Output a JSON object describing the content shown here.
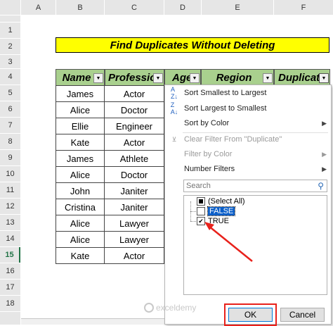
{
  "columns": [
    "A",
    "B",
    "C",
    "D",
    "E",
    "F"
  ],
  "rows": [
    "1",
    "2",
    "3",
    "4",
    "5",
    "6",
    "7",
    "8",
    "9",
    "10",
    "11",
    "12",
    "13",
    "14",
    "15",
    "16",
    "17",
    "18"
  ],
  "title": "Find Duplicates Without Deleting",
  "headers": [
    "Name",
    "Professio",
    "Age",
    "Region",
    "Duplicat"
  ],
  "table": [
    [
      "James",
      "Actor"
    ],
    [
      "Alice",
      "Doctor"
    ],
    [
      "Ellie",
      "Engineer"
    ],
    [
      "Kate",
      "Actor"
    ],
    [
      "James",
      "Athlete"
    ],
    [
      "Alice",
      "Doctor"
    ],
    [
      "John",
      "Janiter"
    ],
    [
      "Cristina",
      "Janiter"
    ],
    [
      "Alice",
      "Lawyer"
    ],
    [
      "Alice",
      "Lawyer"
    ],
    [
      "Kate",
      "Actor"
    ]
  ],
  "menu": {
    "sort_asc": "Sort Smallest to Largest",
    "sort_desc": "Sort Largest to Smallest",
    "sort_color": "Sort by Color",
    "clear_filter": "Clear Filter From \"Duplicate\"",
    "filter_color": "Filter by Color",
    "number_filters": "Number Filters",
    "search_placeholder": "Search",
    "select_all": "(Select All)",
    "opt_false": "FALSE",
    "opt_true": "TRUE",
    "ok": "OK",
    "cancel": "Cancel"
  },
  "watermark": "exceldemy",
  "colors": {
    "title_bg": "#ffff00",
    "header_bg": "#a9d08e",
    "arrow": "#e8211b",
    "selected_highlight": "#0b5fc9"
  }
}
